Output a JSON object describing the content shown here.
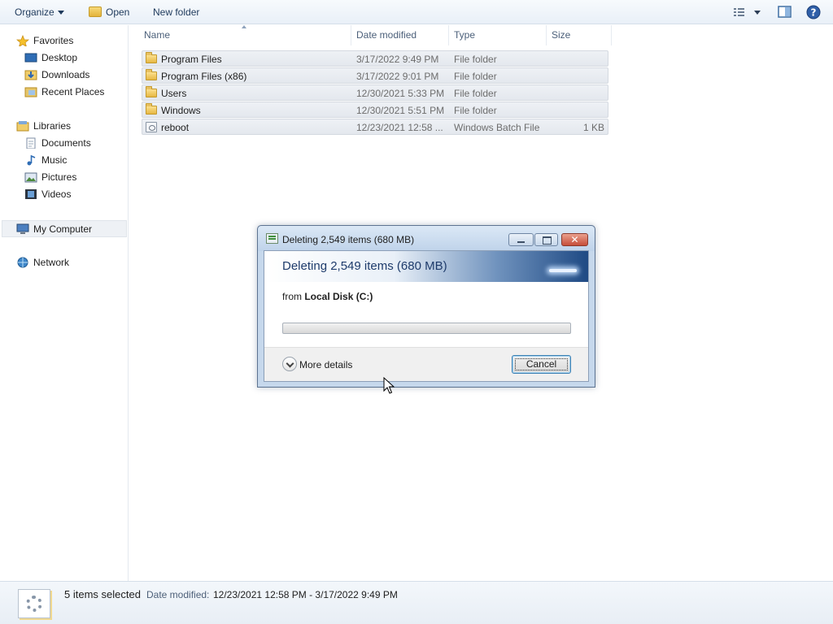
{
  "toolbar": {
    "organize_label": "Organize",
    "open_label": "Open",
    "new_folder_label": "New folder"
  },
  "nav": {
    "favorites": {
      "label": "Favorites",
      "items": [
        {
          "label": "Desktop",
          "icon": "desktop-icon"
        },
        {
          "label": "Downloads",
          "icon": "downloads-icon"
        },
        {
          "label": "Recent Places",
          "icon": "recent-places-icon"
        }
      ]
    },
    "libraries": {
      "label": "Libraries",
      "items": [
        {
          "label": "Documents",
          "icon": "documents-icon"
        },
        {
          "label": "Music",
          "icon": "music-icon"
        },
        {
          "label": "Pictures",
          "icon": "pictures-icon"
        },
        {
          "label": "Videos",
          "icon": "videos-icon"
        }
      ]
    },
    "computer": {
      "label": "My Computer",
      "selected": true
    },
    "network": {
      "label": "Network"
    }
  },
  "columns": {
    "name": "Name",
    "date_modified": "Date modified",
    "type": "Type",
    "size": "Size"
  },
  "files": [
    {
      "name": "Program Files",
      "date": "3/17/2022 9:49 PM",
      "type": "File folder",
      "size": "",
      "kind": "folder"
    },
    {
      "name": "Program Files (x86)",
      "date": "3/17/2022 9:01 PM",
      "type": "File folder",
      "size": "",
      "kind": "folder"
    },
    {
      "name": "Users",
      "date": "12/30/2021 5:33 PM",
      "type": "File folder",
      "size": "",
      "kind": "folder"
    },
    {
      "name": "Windows",
      "date": "12/30/2021 5:51 PM",
      "type": "File folder",
      "size": "",
      "kind": "folder"
    },
    {
      "name": "reboot",
      "date": "12/23/2021 12:58 ...",
      "type": "Windows Batch File",
      "size": "1 KB",
      "kind": "batch"
    }
  ],
  "status": {
    "count": "5 items selected",
    "date_label": "Date modified:",
    "date_value": "12/23/2021 12:58 PM - 3/17/2022 9:49 PM"
  },
  "dialog": {
    "title": "Deleting 2,549 items (680 MB)",
    "heading": "Deleting 2,549 items (680 MB)",
    "from_prefix": "from",
    "from_location": "Local Disk (C:)",
    "progress_fraction": 0,
    "more_details_label": "More details",
    "cancel_label": "Cancel",
    "close_glyph": "✕"
  },
  "colors": {
    "accent": "#1e3b6b",
    "selection_row": "#e4e8ee",
    "progress_green": "#3fae36"
  }
}
